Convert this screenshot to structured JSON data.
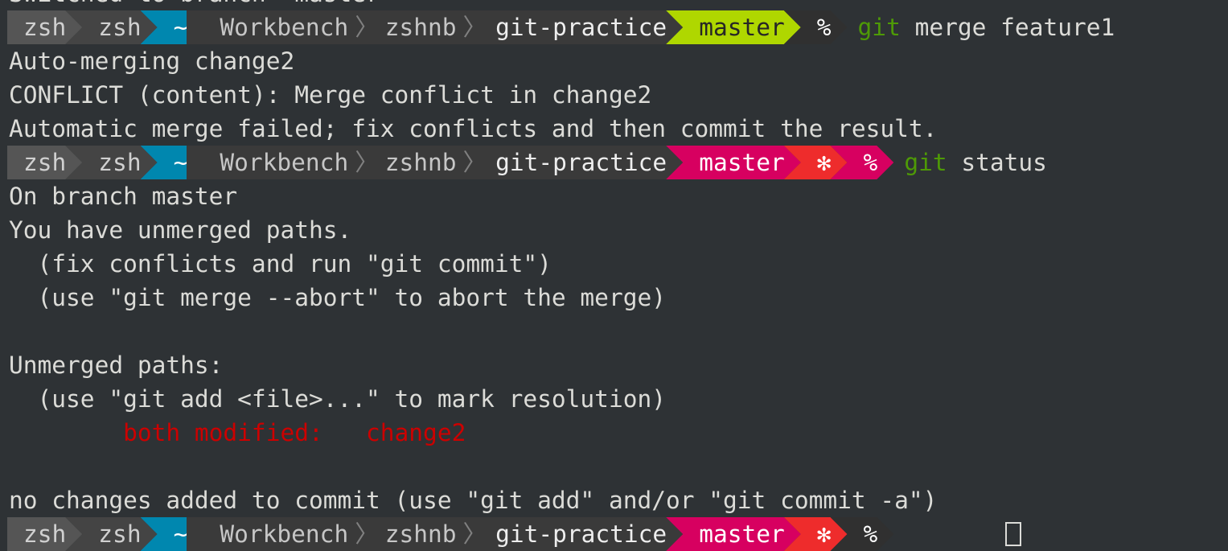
{
  "terminal": {
    "partial_top_line": "Switched to branch 'master'",
    "prompt_segments": {
      "shell1": "zsh",
      "shell2": "zsh",
      "home": "~",
      "path1": "Workbench",
      "path2": "zshnb",
      "dir": "git-practice",
      "branch": "master",
      "dirty_flag": "✻",
      "prompt_char": "%"
    },
    "colors": {
      "branch_clean": "#afd700",
      "branch_dirty": "#d70060",
      "dirty_flag": "#ee2c2c",
      "home": "#0087af",
      "git_keyword": "#4e9a06",
      "error_red": "#cc0000"
    },
    "command1": {
      "keyword": "git",
      "args": " merge feature1"
    },
    "output1": [
      "Auto-merging change2",
      "CONFLICT (content): Merge conflict in change2",
      "Automatic merge failed; fix conflicts and then commit the result."
    ],
    "command2": {
      "keyword": "git",
      "args": " status"
    },
    "output2": [
      "On branch master",
      "You have unmerged paths.",
      "  (fix conflicts and run \"git commit\")",
      "  (use \"git merge --abort\" to abort the merge)",
      "",
      "Unmerged paths:",
      "  (use \"git add <file>...\" to mark resolution)"
    ],
    "unmerged_entry": "        both modified:   change2",
    "output3": [
      "",
      "no changes added to commit (use \"git add\" and/or \"git commit -a\")"
    ]
  }
}
